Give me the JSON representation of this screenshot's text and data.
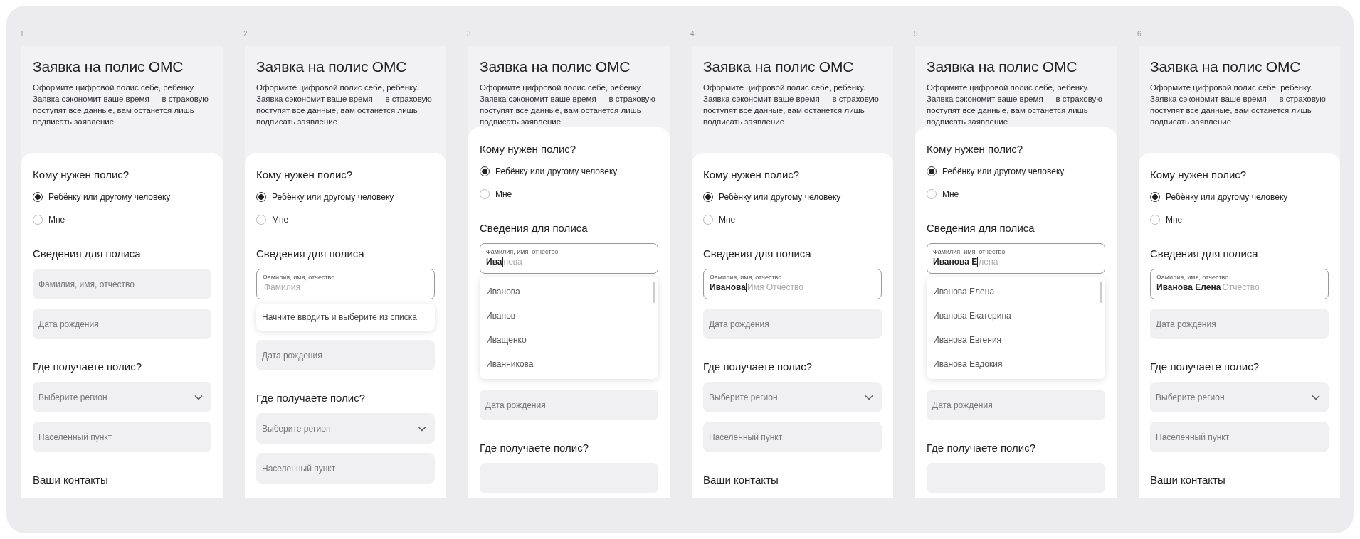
{
  "screens": [
    {
      "number": "1",
      "title": "Заявка на полис ОМС",
      "description": "Оформите цифровой полис себе, ребенку. Заявка сэкономит ваше время — в страховую поступят все данные, вам останется лишь подписать заявление",
      "blocks": [
        {
          "kind": "heading",
          "text": "Кому нужен полис?"
        },
        {
          "kind": "radio",
          "text": "Ребёнку или другому человеку",
          "selected": true
        },
        {
          "kind": "radio",
          "text": "Мне",
          "selected": false
        },
        {
          "kind": "heading",
          "text": "Сведения для полиса"
        },
        {
          "kind": "field",
          "placeholder": "Фамилия, имя, отчество"
        },
        {
          "kind": "field",
          "placeholder": "Дата рождения"
        },
        {
          "kind": "heading",
          "text": "Где получаете полис?"
        },
        {
          "kind": "select",
          "placeholder": "Выберите регион"
        },
        {
          "kind": "field",
          "placeholder": "Населенный пункт"
        },
        {
          "kind": "heading",
          "text": "Ваши контакты"
        }
      ]
    },
    {
      "number": "2",
      "title": "Заявка на полис ОМС",
      "description": "Оформите цифровой полис себе, ребенку. Заявка сэкономит ваше время — в страховую поступят все данные, вам останется лишь подписать заявление",
      "blocks": [
        {
          "kind": "heading",
          "text": "Кому нужен полис?"
        },
        {
          "kind": "radio",
          "text": "Ребёнку или другому человеку",
          "selected": true
        },
        {
          "kind": "radio",
          "text": "Мне",
          "selected": false
        },
        {
          "kind": "heading",
          "text": "Сведения для полиса"
        },
        {
          "kind": "input",
          "label": "Фамилия, имя, отчество",
          "completion": "Фамилия"
        },
        {
          "kind": "hint",
          "text": "Начните вводить и выберите из списка"
        },
        {
          "kind": "field",
          "placeholder": "Дата рождения"
        },
        {
          "kind": "heading",
          "text": "Где получаете полис?"
        },
        {
          "kind": "select",
          "placeholder": "Выберите регион"
        },
        {
          "kind": "field",
          "placeholder": "Населенный пункт"
        }
      ]
    },
    {
      "number": "3",
      "title": "Заявка на полис ОМС",
      "description": "Оформите цифровой полис себе, ребенку. Заявка сэкономит ваше время — в страховую поступят все данные, вам останется лишь подписать заявление",
      "blocks": [
        {
          "kind": "heading",
          "text": "Кому нужен полис?"
        },
        {
          "kind": "radio",
          "text": "Ребёнку или другому человеку",
          "selected": true
        },
        {
          "kind": "radio",
          "text": "Мне",
          "selected": false
        },
        {
          "kind": "heading",
          "text": "Сведения для полиса"
        },
        {
          "kind": "input",
          "label": "Фамилия, имя, отчество",
          "value": "Ива",
          "completion": "нова"
        },
        {
          "kind": "list",
          "items": [
            "Иванова",
            "Иванов",
            "Иващенко",
            "Иванникова"
          ]
        },
        {
          "kind": "field",
          "placeholder": "Дата рождения"
        },
        {
          "kind": "heading",
          "text": "Где получаете полис?"
        },
        {
          "kind": "stub"
        }
      ]
    },
    {
      "number": "4",
      "title": "Заявка на полис ОМС",
      "description": "Оформите цифровой полис себе, ребенку. Заявка сэкономит ваше время — в страховую поступят все данные, вам останется лишь подписать заявление",
      "blocks": [
        {
          "kind": "heading",
          "text": "Кому нужен полис?"
        },
        {
          "kind": "radio",
          "text": "Ребёнку или другому человеку",
          "selected": true
        },
        {
          "kind": "radio",
          "text": "Мне",
          "selected": false
        },
        {
          "kind": "heading",
          "text": "Сведения для полиса"
        },
        {
          "kind": "input",
          "label": "Фамилия, имя, отчество",
          "value": "Иванова",
          "completion": "Имя Отчество"
        },
        {
          "kind": "field",
          "placeholder": "Дата рождения"
        },
        {
          "kind": "heading",
          "text": "Где получаете полис?"
        },
        {
          "kind": "select",
          "placeholder": "Выберите регион"
        },
        {
          "kind": "field",
          "placeholder": "Населенный пункт"
        },
        {
          "kind": "heading",
          "text": "Ваши контакты"
        }
      ]
    },
    {
      "number": "5",
      "title": "Заявка на полис ОМС",
      "description": "Оформите цифровой полис себе, ребенку. Заявка сэкономит ваше время — в страховую поступят все данные, вам останется лишь подписать заявление",
      "blocks": [
        {
          "kind": "heading",
          "text": "Кому нужен полис?"
        },
        {
          "kind": "radio",
          "text": "Ребёнку или другому человеку",
          "selected": true
        },
        {
          "kind": "radio",
          "text": "Мне",
          "selected": false
        },
        {
          "kind": "heading",
          "text": "Сведения для полиса"
        },
        {
          "kind": "input",
          "label": "Фамилия, имя, отчество",
          "value": "Иванова Е",
          "completion": "лена"
        },
        {
          "kind": "list",
          "items": [
            "Иванова Елена",
            "Иванова Екатерина",
            "Иванова Евгения",
            "Иванова Евдокия"
          ]
        },
        {
          "kind": "field",
          "placeholder": "Дата рождения"
        },
        {
          "kind": "heading",
          "text": "Где получаете полис?"
        },
        {
          "kind": "stub"
        }
      ]
    },
    {
      "number": "6",
      "title": "Заявка на полис ОМС",
      "description": "Оформите цифровой полис себе, ребенку. Заявка сэкономит ваше время — в страховую поступят все данные, вам останется лишь подписать заявление",
      "blocks": [
        {
          "kind": "heading",
          "text": "Кому нужен полис?"
        },
        {
          "kind": "radio",
          "text": "Ребёнку или другому человеку",
          "selected": true
        },
        {
          "kind": "radio",
          "text": "Мне",
          "selected": false
        },
        {
          "kind": "heading",
          "text": "Сведения для полиса"
        },
        {
          "kind": "input",
          "label": "Фамилия, имя, отчество",
          "value": "Иванова Елена",
          "completion": "Отчество"
        },
        {
          "kind": "field",
          "placeholder": "Дата рождения"
        },
        {
          "kind": "heading",
          "text": "Где получаете полис?"
        },
        {
          "kind": "select",
          "placeholder": "Выберите регион"
        },
        {
          "kind": "field",
          "placeholder": "Населенный пункт"
        },
        {
          "kind": "heading",
          "text": "Ваши контакты"
        }
      ]
    }
  ]
}
